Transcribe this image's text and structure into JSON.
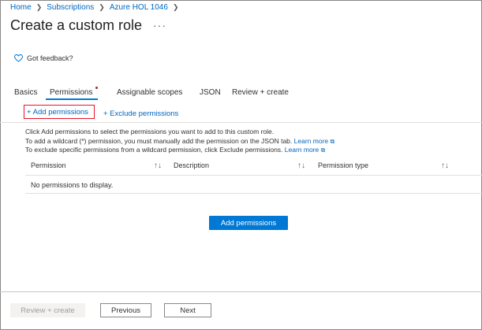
{
  "breadcrumb": [
    "Home",
    "Subscriptions",
    "Azure HOL 1046"
  ],
  "page": {
    "title": "Create a custom role",
    "more": "···"
  },
  "feedback": {
    "label": "Got feedback?"
  },
  "tabs": [
    {
      "label": "Basics"
    },
    {
      "label": "Permissions"
    },
    {
      "label": "Assignable scopes"
    },
    {
      "label": "JSON"
    },
    {
      "label": "Review + create"
    }
  ],
  "toolbar": {
    "add_label": "+ Add permissions",
    "exclude_label": "+ Exclude permissions"
  },
  "info": {
    "line1": "Click Add permissions to select the permissions you want to add to this custom role.",
    "line2": "To add a wildcard (*) permission, you must manually add the permission on the JSON tab.",
    "line3": "To exclude specific permissions from a wildcard permission, click Exclude permissions.",
    "learn_more": "Learn more"
  },
  "table": {
    "columns": [
      "Permission",
      "Description",
      "Permission type"
    ],
    "empty": "No permissions to display."
  },
  "main_add_label": "Add permissions",
  "footer": {
    "review_label": "Review + create",
    "previous_label": "Previous",
    "next_label": "Next"
  },
  "colors": {
    "accent": "#0078d4",
    "link": "#0066c0",
    "highlight": "#e81123"
  }
}
